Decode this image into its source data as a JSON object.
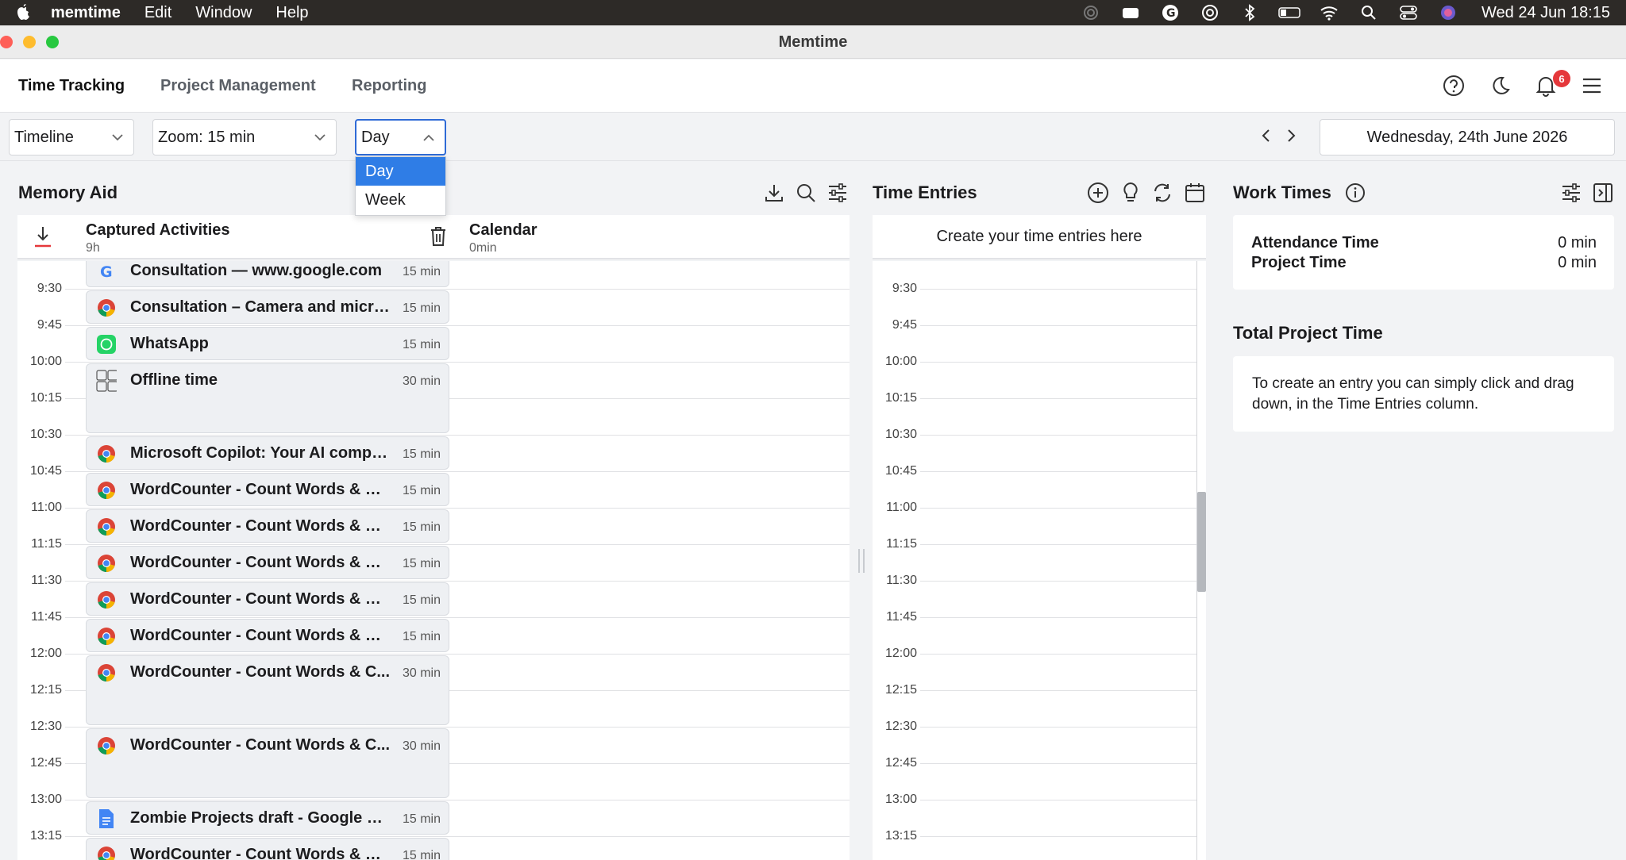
{
  "menubar": {
    "app": "memtime",
    "items": [
      "Edit",
      "Window",
      "Help"
    ],
    "clock": "Wed 24 Jun  18:15"
  },
  "window": {
    "title": "Memtime"
  },
  "nav": {
    "tabs": [
      "Time Tracking",
      "Project Management",
      "Reporting"
    ],
    "notifications_count": "6"
  },
  "toolbar": {
    "view_select": "Timeline",
    "zoom_select": "Zoom: 15 min",
    "range_select": "Day",
    "range_options": [
      "Day",
      "Week"
    ],
    "date": "Wednesday, 24th June 2026"
  },
  "memory_aid": {
    "title": "Memory Aid",
    "captured_label": "Captured Activities",
    "captured_total": "9h",
    "calendar_label": "Calendar",
    "calendar_total": "0min",
    "times": [
      "9:30",
      "9:45",
      "10:00",
      "10:15",
      "10:30",
      "10:45",
      "11:00",
      "11:15",
      "11:30",
      "11:45",
      "12:00",
      "12:15",
      "12:30",
      "12:45",
      "13:00",
      "13:15"
    ],
    "activities": [
      {
        "name": "Consultation — www.google.com",
        "duration": "15 min",
        "icon": "google-icon"
      },
      {
        "name": "Consultation – Camera and micro...",
        "duration": "15 min",
        "icon": "chrome-icon"
      },
      {
        "name": "WhatsApp",
        "duration": "15 min",
        "icon": "whatsapp-icon"
      },
      {
        "name": "Offline time",
        "duration": "30 min",
        "icon": "offline-icon"
      },
      {
        "name": "Microsoft Copilot: Your AI compa...",
        "duration": "15 min",
        "icon": "chrome-icon"
      },
      {
        "name": "WordCounter - Count Words & Co...",
        "duration": "15 min",
        "icon": "chrome-icon"
      },
      {
        "name": "WordCounter - Count Words & Co...",
        "duration": "15 min",
        "icon": "chrome-icon"
      },
      {
        "name": "WordCounter - Count Words & Co...",
        "duration": "15 min",
        "icon": "chrome-icon"
      },
      {
        "name": "WordCounter - Count Words & Co...",
        "duration": "15 min",
        "icon": "chrome-icon"
      },
      {
        "name": "WordCounter - Count Words & Co...",
        "duration": "15 min",
        "icon": "chrome-icon"
      },
      {
        "name": "WordCounter - Count Words & C...",
        "duration": "30 min",
        "icon": "chrome-icon"
      },
      {
        "name": "WordCounter - Count Words & C...",
        "duration": "30 min",
        "icon": "chrome-icon"
      },
      {
        "name": "Zombie Projects draft - Google Do...",
        "duration": "15 min",
        "icon": "google-docs-icon"
      },
      {
        "name": "WordCounter - Count Words & Co...",
        "duration": "15 min",
        "icon": "chrome-icon"
      }
    ]
  },
  "time_entries": {
    "title": "Time Entries",
    "placeholder": "Create your time entries here"
  },
  "work_times": {
    "title": "Work Times",
    "attendance_label": "Attendance Time",
    "attendance_value": "0 min",
    "project_label": "Project Time",
    "project_value": "0 min",
    "total_title": "Total Project Time",
    "total_hint": "To create an entry you can simply click and drag down, in the Time Entries column."
  },
  "colors": {
    "accent": "#2f7de6",
    "badge": "#e5383b"
  }
}
